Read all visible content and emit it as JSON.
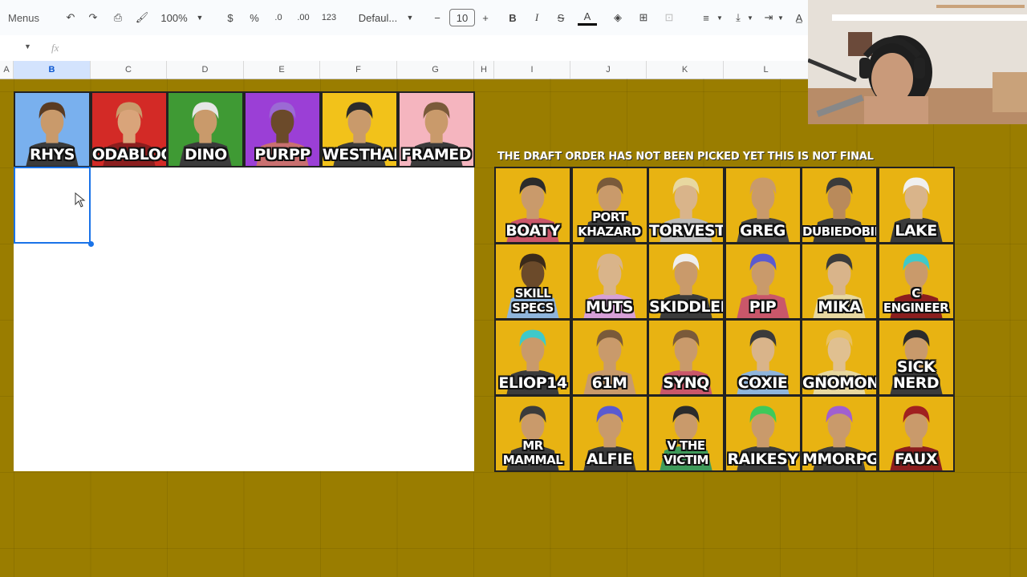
{
  "toolbar": {
    "menus_label": "Menus",
    "zoom": "100%",
    "currency": "$",
    "percent": "%",
    "dec_decrease": ".0",
    "dec_increase": ".00",
    "format_number": "123",
    "font": "Defaul...",
    "font_size": "10",
    "bold": "B",
    "italic": "I",
    "text_color_label": "A"
  },
  "formula_bar": {
    "fx": "fx"
  },
  "columns": [
    "A",
    "B",
    "C",
    "D",
    "E",
    "F",
    "G",
    "H",
    "I",
    "J",
    "K",
    "L"
  ],
  "notice": "THE DRAFT ORDER HAS NOT BEEN PICKED YET THIS IS NOT FINAL",
  "captains": [
    {
      "name": "RHYS",
      "bg": "#79b0ee",
      "hair": "#5a3b22",
      "skin": "#c99a6b",
      "body": "#3b3b3b"
    },
    {
      "name": "ODABLOCK",
      "bg": "#d32a26",
      "hair": "#c99a6b",
      "skin": "#d9a47a",
      "body": "#8b1e1e"
    },
    {
      "name": "DINO",
      "bg": "#3f9a34",
      "hair": "#e6e6e6",
      "skin": "#c99a6b",
      "body": "#3b3b3b"
    },
    {
      "name": "PURPP",
      "bg": "#9b3fd6",
      "hair": "#9b6ad4",
      "skin": "#6b4a2a",
      "body": "#c97070"
    },
    {
      "name": "WESTHAM",
      "bg": "#f2c21a",
      "hair": "#2b2b2b",
      "skin": "#c99a6b",
      "body": "#3b3b3b"
    },
    {
      "name": "FRAMED",
      "bg": "#f5b5bf",
      "hair": "#7a5a3a",
      "skin": "#c99a6b",
      "body": "#3b3b3b"
    }
  ],
  "players": [
    {
      "name": "BOATY",
      "bg": "#e8b312",
      "hair": "#2b2b2b",
      "skin": "#c99a6b",
      "body": "#c9576a"
    },
    {
      "name": "PORT\nKHAZARD",
      "bg": "#e8b312",
      "hair": "#7a5a3a",
      "skin": "#c99a6b",
      "body": "#3b3b3b"
    },
    {
      "name": "TORVESTA",
      "bg": "#e8b312",
      "hair": "#e8d8a0",
      "skin": "#d9b48a",
      "body": "#bbbbbb"
    },
    {
      "name": "GREG",
      "bg": "#e8b312",
      "hair": "#c99a6b",
      "skin": "#c99a6b",
      "body": "#444444"
    },
    {
      "name": "DUBIEDOBIES",
      "bg": "#e8b312",
      "hair": "#3b3b3b",
      "skin": "#b98a5b",
      "body": "#3b3b3b"
    },
    {
      "name": "LAKE",
      "bg": "#e8b312",
      "hair": "#f0f0f0",
      "skin": "#d9b48a",
      "body": "#3b3b3b"
    },
    {
      "name": "SKILL\nSPECS",
      "bg": "#e8b312",
      "hair": "#3b2a1a",
      "skin": "#6b4a2a",
      "body": "#8fb5dc"
    },
    {
      "name": "MUTS",
      "bg": "#e8b312",
      "hair": "#d9b48a",
      "skin": "#d9b48a",
      "body": "#d7a0d8"
    },
    {
      "name": "SKIDDLER",
      "bg": "#e8b312",
      "hair": "#eeeeee",
      "skin": "#c99a6b",
      "body": "#3b3b3b"
    },
    {
      "name": "PIP",
      "bg": "#e8b312",
      "hair": "#5a5ad0",
      "skin": "#c99a6b",
      "body": "#c9576a"
    },
    {
      "name": "MIKA",
      "bg": "#e8b312",
      "hair": "#3b3b3b",
      "skin": "#d9b48a",
      "body": "#e8d8a0"
    },
    {
      "name": "C ENGINEER",
      "bg": "#e8b312",
      "hair": "#3fc9c9",
      "skin": "#c99a6b",
      "body": "#8b1e1e"
    },
    {
      "name": "ELIOP14",
      "bg": "#e8b312",
      "hair": "#3fc9c9",
      "skin": "#c99a6b",
      "body": "#3b3b3b"
    },
    {
      "name": "61M",
      "bg": "#e8b312",
      "hair": "#7a5a3a",
      "skin": "#c99a6b",
      "body": "#c99a6b"
    },
    {
      "name": "SYNQ",
      "bg": "#e8b312",
      "hair": "#7a5a3a",
      "skin": "#c99a6b",
      "body": "#c9576a"
    },
    {
      "name": "COXIE",
      "bg": "#e8b312",
      "hair": "#3b3b3b",
      "skin": "#d9b48a",
      "body": "#8fb5dc"
    },
    {
      "name": "GNOMONKEY",
      "bg": "#e8b312",
      "hair": "#e8c060",
      "skin": "#e0c090",
      "body": "#e8d8a0"
    },
    {
      "name": "SICK NERD",
      "bg": "#e8b312",
      "hair": "#2b2b2b",
      "skin": "#c99a6b",
      "body": "#3b3b3b"
    },
    {
      "name": "MR\nMAMMAL",
      "bg": "#e8b312",
      "hair": "#3b3b3b",
      "skin": "#c99a6b",
      "body": "#3b3b3b"
    },
    {
      "name": "ALFIE",
      "bg": "#e8b312",
      "hair": "#5a5ad0",
      "skin": "#c99a6b",
      "body": "#3b3b3b"
    },
    {
      "name": "V THE VICTIM",
      "bg": "#e8b312",
      "hair": "#2b2b2b",
      "skin": "#c99a6b",
      "body": "#3f9a5a"
    },
    {
      "name": "RAIKESY",
      "bg": "#e8b312",
      "hair": "#3fc95a",
      "skin": "#c99a6b",
      "body": "#3b3b3b"
    },
    {
      "name": "MMORPG",
      "bg": "#e8b312",
      "hair": "#a060d0",
      "skin": "#c99a6b",
      "body": "#3b3b3b"
    },
    {
      "name": "FAUX",
      "bg": "#e8b312",
      "hair": "#a02020",
      "skin": "#c99a6b",
      "body": "#8b1e1e"
    }
  ]
}
